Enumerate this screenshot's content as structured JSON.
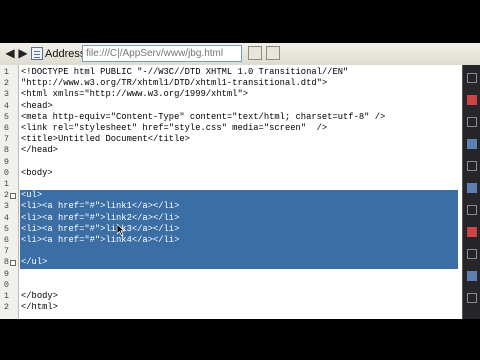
{
  "toolbar": {
    "address_label": "Address:",
    "address_value": "file:///C|/AppServ/www/jbg.html",
    "back_icon": "back-arrow-icon",
    "forward_icon": "forward-arrow-icon",
    "page_icon": "document-icon"
  },
  "editor": {
    "selection_color": "#3a6ea5",
    "gutter": [
      {
        "label": "1"
      },
      {
        "label": "2"
      },
      {
        "label": "3"
      },
      {
        "label": "4"
      },
      {
        "label": "5"
      },
      {
        "label": "6"
      },
      {
        "label": "7"
      },
      {
        "label": "8"
      },
      {
        "label": "9"
      },
      {
        "label": "0"
      },
      {
        "label": "1"
      },
      {
        "label": "2"
      },
      {
        "label": "3"
      },
      {
        "label": "4"
      },
      {
        "label": "5"
      },
      {
        "label": "6"
      },
      {
        "label": "7"
      },
      {
        "label": "8"
      },
      {
        "label": "9"
      },
      {
        "label": "0"
      },
      {
        "label": "1"
      },
      {
        "label": "2"
      }
    ],
    "lines": [
      "<!DOCTYPE html PUBLIC \"-//W3C//DTD XHTML 1.0 Transitional//EN\"",
      "\"http://www.w3.org/TR/xhtml1/DTD/xhtml1-transitional.dtd\">",
      "<html xmlns=\"http://www.w3.org/1999/xhtml\">",
      "<head>",
      "<meta http-equiv=\"Content-Type\" content=\"text/html; charset=utf-8\" />",
      "<link rel=\"stylesheet\" href=\"style.css\" media=\"screen\"  />",
      "<title>Untitled Document</title>",
      "</head>",
      "",
      "<body>",
      "",
      "<ul>",
      "<li><a href=\"#\">link1</a></li>",
      "<li><a href=\"#\">link2</a></li>",
      "<li><a href=\"#\">link3</a></li>",
      "<li><a href=\"#\">link4</a></li>",
      "",
      "</ul>",
      "",
      "",
      "</body>",
      "</html>"
    ]
  }
}
